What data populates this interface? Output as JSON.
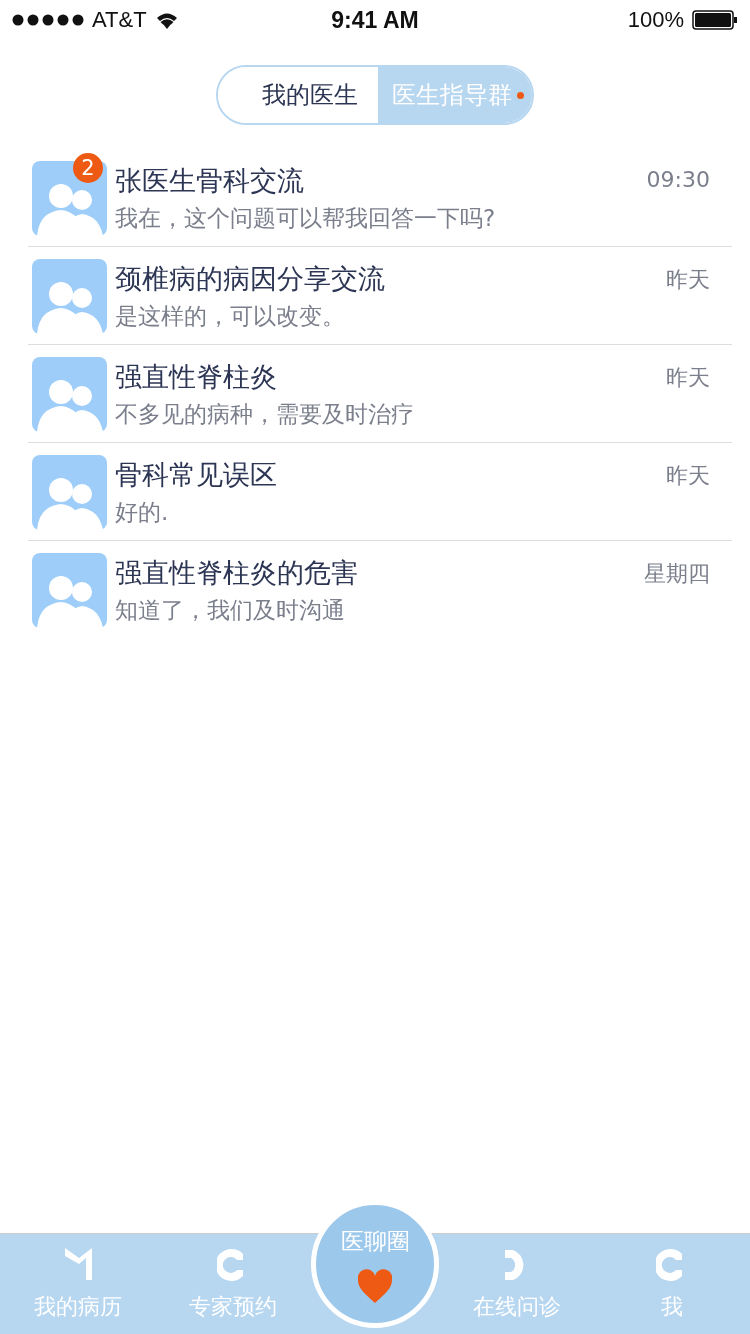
{
  "status_bar": {
    "carrier": "AT&T",
    "time": "9:41 AM",
    "battery": "100%"
  },
  "segments": [
    {
      "label": "我的医生",
      "selected": false,
      "dot": false
    },
    {
      "label": "医生指导群",
      "selected": true,
      "dot": true
    }
  ],
  "chats": [
    {
      "title": "张医生骨科交流",
      "message": "我在，这个问题可以帮我回答一下吗?",
      "time": "09:30",
      "unread": "2"
    },
    {
      "title": "颈椎病的病因分享交流",
      "message": "是这样的，可以改变。",
      "time": "昨天"
    },
    {
      "title": "强直性脊柱炎",
      "message": "不多见的病种，需要及时治疗",
      "time": "昨天"
    },
    {
      "title": "骨科常见误区",
      "message": "好的.",
      "time": "昨天"
    },
    {
      "title": "强直性脊柱炎的危害",
      "message": "知道了，我们及时沟通",
      "time": "星期四"
    }
  ],
  "tab_bar": [
    {
      "kind": "tab",
      "label": "我的病历"
    },
    {
      "kind": "tab",
      "label": "专家预约"
    },
    {
      "kind": "center",
      "label": "医聊圈"
    },
    {
      "kind": "tab",
      "label": "在线问诊"
    },
    {
      "kind": "tab",
      "label": "我"
    }
  ]
}
